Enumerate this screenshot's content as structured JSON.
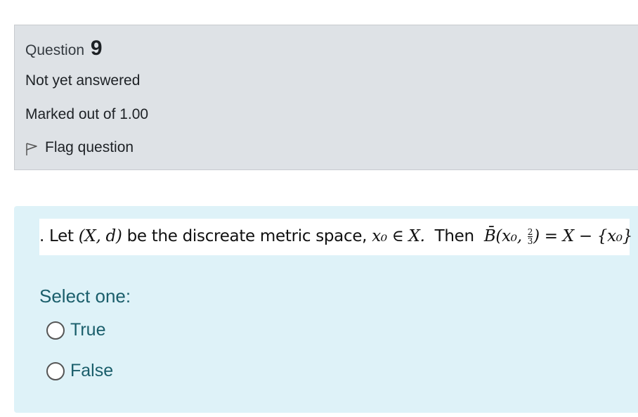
{
  "info": {
    "question_label": "Question",
    "question_number": "9",
    "state": "Not yet answered",
    "grade": "Marked out of 1.00",
    "flag_label": "Flag question"
  },
  "question": {
    "text_prefix": ". Let ",
    "space_expr": "(X, d)",
    "text_mid": " be the discreate metric space, ",
    "point_expr": "x₀ ∈ X.",
    "text_then": "  Then  ",
    "ball_expr": "B̄(x₀, ",
    "frac_num": "2",
    "frac_den": "3",
    "rhs_expr": ") = X − {x₀}"
  },
  "answer": {
    "prompt": "Select one:",
    "options": [
      "True",
      "False"
    ]
  }
}
